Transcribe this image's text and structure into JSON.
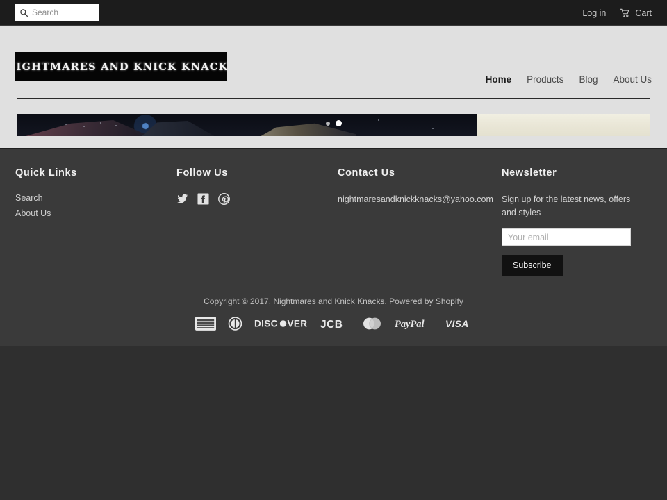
{
  "topbar": {
    "search": {
      "icon": "search-icon",
      "placeholder": "Search",
      "value": ""
    },
    "login_label": "Log in",
    "cart_label": "Cart",
    "cart_icon": "cart-icon"
  },
  "header": {
    "logo": {
      "text": "NIGHTMARES AND KNICK KNACKS",
      "left_icon": "skull-icon",
      "right_icon": "skull-icon",
      "background": "#050505"
    },
    "nav": [
      {
        "label": "Home",
        "active": true
      },
      {
        "label": "Products",
        "active": false
      },
      {
        "label": "Blog",
        "active": false
      },
      {
        "label": "About Us",
        "active": false
      }
    ]
  },
  "slideshow": {
    "slides": [
      {
        "name": "slide-1",
        "description": "dark night scene"
      },
      {
        "name": "slide-2",
        "description": "cream parchment"
      }
    ],
    "dots": [
      {
        "active": false
      },
      {
        "active": true
      }
    ]
  },
  "footer": {
    "quick_links": {
      "title": "Quick Links",
      "items": [
        {
          "label": "Search"
        },
        {
          "label": "About Us"
        }
      ]
    },
    "follow_us": {
      "title": "Follow Us",
      "socials": [
        {
          "name": "twitter-icon",
          "label": "Twitter"
        },
        {
          "name": "facebook-icon",
          "label": "Facebook"
        },
        {
          "name": "pinterest-icon",
          "label": "Pinterest"
        }
      ]
    },
    "contact_us": {
      "title": "Contact Us",
      "email": "nightmaresandknickknacks@yahoo.com"
    },
    "newsletter": {
      "title": "Newsletter",
      "description": "Sign up for the latest news, offers and styles",
      "email_placeholder": "Your email",
      "email_value": "",
      "subscribe_label": "Subscribe"
    },
    "copyright": "Copyright © 2017, Nightmares and Knick Knacks. Powered by Shopify",
    "payment_methods": [
      {
        "name": "american-express-icon",
        "label": "American Express"
      },
      {
        "name": "diners-club-icon",
        "label": "Diners Club"
      },
      {
        "name": "discover-icon",
        "label": "Discover"
      },
      {
        "name": "jcb-icon",
        "label": "JCB"
      },
      {
        "name": "mastercard-icon",
        "label": "Mastercard"
      },
      {
        "name": "paypal-icon",
        "label": "PayPal"
      },
      {
        "name": "visa-icon",
        "label": "Visa"
      }
    ]
  },
  "colors": {
    "topbar_bg": "#1c1c1c",
    "page_bg": "#e0e0e0",
    "footer_bg": "#3a3a3a",
    "button_bg": "#111111",
    "text_light": "#d2d2d2"
  }
}
